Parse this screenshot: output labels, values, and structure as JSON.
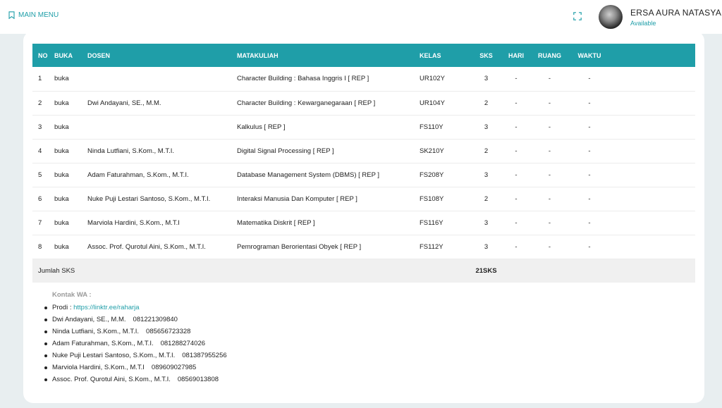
{
  "topbar": {
    "menu_label": "MAIN MENU",
    "user_name": "ERSA AURA NATASYA",
    "user_status": "Available"
  },
  "table": {
    "headers": [
      "NO",
      "BUKA",
      "DOSEN",
      "MATAKULIAH",
      "KELAS",
      "SKS",
      "HARI",
      "RUANG",
      "WAKTU"
    ],
    "rows": [
      {
        "no": "1",
        "buka": "buka",
        "dosen": "",
        "matakuliah": "Character Building : Bahasa Inggris I [ REP ]",
        "kelas": "UR102Y",
        "sks": "3",
        "hari": "-",
        "ruang": "-",
        "waktu": "-"
      },
      {
        "no": "2",
        "buka": "buka",
        "dosen": "Dwi Andayani, SE., M.M.",
        "matakuliah": "Character Building : Kewarganegaraan [ REP ]",
        "kelas": "UR104Y",
        "sks": "2",
        "hari": "-",
        "ruang": "-",
        "waktu": "-"
      },
      {
        "no": "3",
        "buka": "buka",
        "dosen": "",
        "matakuliah": "Kalkulus [ REP ]",
        "kelas": "FS110Y",
        "sks": "3",
        "hari": "-",
        "ruang": "-",
        "waktu": "-"
      },
      {
        "no": "4",
        "buka": "buka",
        "dosen": "Ninda Lutfiani, S.Kom., M.T.I.",
        "matakuliah": "Digital Signal Processing [ REP ]",
        "kelas": "SK210Y",
        "sks": "2",
        "hari": "-",
        "ruang": "-",
        "waktu": "-"
      },
      {
        "no": "5",
        "buka": "buka",
        "dosen": "Adam Faturahman, S.Kom., M.T.I.",
        "matakuliah": "Database Management System (DBMS) [ REP ]",
        "kelas": "FS208Y",
        "sks": "3",
        "hari": "-",
        "ruang": "-",
        "waktu": "-"
      },
      {
        "no": "6",
        "buka": "buka",
        "dosen": "Nuke Puji Lestari Santoso, S.Kom., M.T.I.",
        "matakuliah": "Interaksi Manusia Dan Komputer [ REP ]",
        "kelas": "FS108Y",
        "sks": "2",
        "hari": "-",
        "ruang": "-",
        "waktu": "-"
      },
      {
        "no": "7",
        "buka": "buka",
        "dosen": "Marviola Hardini, S.Kom., M.T.I",
        "matakuliah": "Matematika Diskrit [ REP ]",
        "kelas": "FS116Y",
        "sks": "3",
        "hari": "-",
        "ruang": "-",
        "waktu": "-"
      },
      {
        "no": "8",
        "buka": "buka",
        "dosen": "Assoc. Prof. Qurotul Aini, S.Kom., M.T.I.",
        "matakuliah": "Pemrograman Berorientasi Obyek [ REP ]",
        "kelas": "FS112Y",
        "sks": "3",
        "hari": "-",
        "ruang": "-",
        "waktu": "-"
      }
    ],
    "total_label": "Jumlah SKS",
    "total_value": "21SKS"
  },
  "contact": {
    "title": "Kontak WA :",
    "prodi_label": "Prodi : ",
    "prodi_link": "https://linktr.ee/raharja",
    "entries": [
      {
        "name": "Dwi Andayani, SE., M.M.",
        "phone": "081221309840"
      },
      {
        "name": "Ninda Lutfiani, S.Kom., M.T.I.",
        "phone": "085656723328"
      },
      {
        "name": "Adam Faturahman, S.Kom., M.T.I.",
        "phone": "081288274026"
      },
      {
        "name": "Nuke Puji Lestari Santoso, S.Kom., M.T.I.",
        "phone": "081387955256"
      },
      {
        "name": "Marviola Hardini, S.Kom., M.T.I",
        "phone": "089609027985"
      },
      {
        "name": "Assoc. Prof. Qurotul Aini, S.Kom., M.T.I.",
        "phone": "08569013808"
      }
    ]
  },
  "colors": {
    "accent": "#1f9ea8",
    "page_bg": "#e8eef0",
    "total_row_bg": "#f0f0f0"
  },
  "icons": {
    "menu": "bookmark-icon",
    "fullscreen": "fullscreen-icon",
    "avatar": "user-avatar"
  }
}
